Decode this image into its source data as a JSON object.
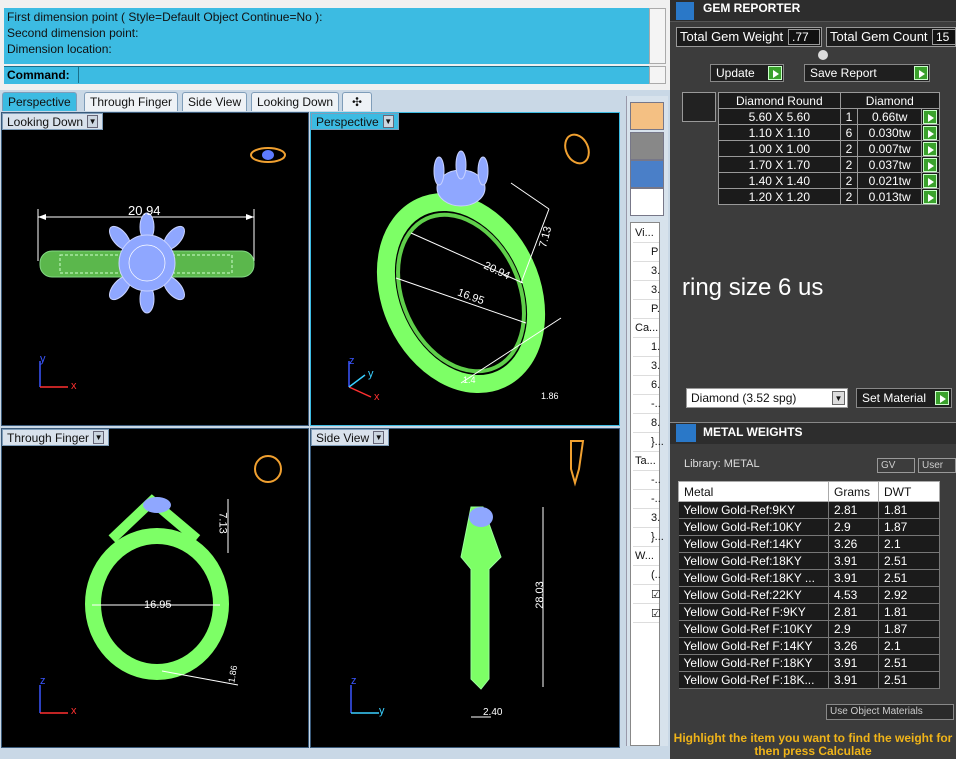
{
  "command": {
    "history": [
      "First dimension point ( Style=Default  Object  Continue=No ):",
      "Second dimension point:",
      "Dimension location:"
    ],
    "prompt_label": "Command:",
    "input_value": ""
  },
  "tabs": [
    "Perspective",
    "Through Finger",
    "Side View",
    "Looking Down"
  ],
  "viewports": {
    "top_left": {
      "label": "Looking Down",
      "dimension": "20.94"
    },
    "top_right": {
      "label": "Perspective",
      "dims": [
        "7.13",
        "20.94",
        "16.95",
        "1.4",
        "1.86"
      ]
    },
    "bottom_left": {
      "label": "Through Finger",
      "dims": [
        "7.13",
        "16.95",
        "1.86"
      ]
    },
    "bottom_right": {
      "label": "Side View",
      "dims": [
        "28.03",
        "2.40"
      ]
    }
  },
  "axes": {
    "x": "x",
    "y": "y",
    "z": "z"
  },
  "side_list": [
    "Vi...",
    "P",
    "3.",
    "3.",
    "P.",
    "Ca...",
    "1.",
    "3.",
    "6.",
    "-..",
    "8.",
    "}...",
    "Ta...",
    "-..",
    "-..",
    "3.",
    "}...",
    "W...",
    "(..",
    "☑",
    "☑"
  ],
  "gem_reporter": {
    "title": "GEM REPORTER",
    "total_weight_label": "Total Gem Weight",
    "total_weight_value": ".77",
    "total_count_label": "Total Gem Count",
    "total_count_value": "15",
    "update_label": "Update",
    "save_report_label": "Save Report",
    "table_header": [
      "Diamond Round",
      "Diamond"
    ],
    "rows": [
      {
        "size": "5.60 X 5.60",
        "count": "1",
        "weight": "0.66tw"
      },
      {
        "size": "1.10 X 1.10",
        "count": "6",
        "weight": "0.030tw"
      },
      {
        "size": "1.00 X 1.00",
        "count": "2",
        "weight": "0.007tw"
      },
      {
        "size": "1.70 X 1.70",
        "count": "2",
        "weight": "0.037tw"
      },
      {
        "size": "1.40 X 1.40",
        "count": "2",
        "weight": "0.021tw"
      },
      {
        "size": "1.20 X 1.20",
        "count": "2",
        "weight": "0.013tw"
      }
    ],
    "note": "ring size 6 us",
    "material_select": "Diamond     (3.52 spg)",
    "set_material_label": "Set Material"
  },
  "metal_weights": {
    "title": "METAL WEIGHTS",
    "library_label": "Library: METAL",
    "gv_label": "GV",
    "user_label": "User",
    "columns": [
      "Metal",
      "Grams",
      "DWT"
    ],
    "rows": [
      [
        "Yellow Gold-Ref:9KY",
        "2.81",
        "1.81"
      ],
      [
        "Yellow Gold-Ref:10KY",
        "2.9",
        "1.87"
      ],
      [
        "Yellow Gold-Ref:14KY",
        "3.26",
        "2.1"
      ],
      [
        "Yellow Gold-Ref:18KY",
        "3.91",
        "2.51"
      ],
      [
        "Yellow Gold-Ref:18KY ...",
        "3.91",
        "2.51"
      ],
      [
        "Yellow Gold-Ref:22KY",
        "4.53",
        "2.92"
      ],
      [
        "Yellow Gold-Ref F:9KY",
        "2.81",
        "1.81"
      ],
      [
        "Yellow Gold-Ref F:10KY",
        "2.9",
        "1.87"
      ],
      [
        "Yellow Gold-Ref F:14KY",
        "3.26",
        "2.1"
      ],
      [
        "Yellow Gold-Ref F:18KY",
        "3.91",
        "2.51"
      ],
      [
        "Yellow Gold-Ref F:18K...",
        "3.91",
        "2.51"
      ]
    ],
    "use_object_materials": "Use Object Materials",
    "footer": "Highlight the item you want to find the weight for then press Calculate"
  },
  "colors": {
    "accent": "#3cbbe2",
    "ring_green": "#7dff66",
    "gem_blue": "#8fa7ff",
    "gold": "#f0b419"
  }
}
